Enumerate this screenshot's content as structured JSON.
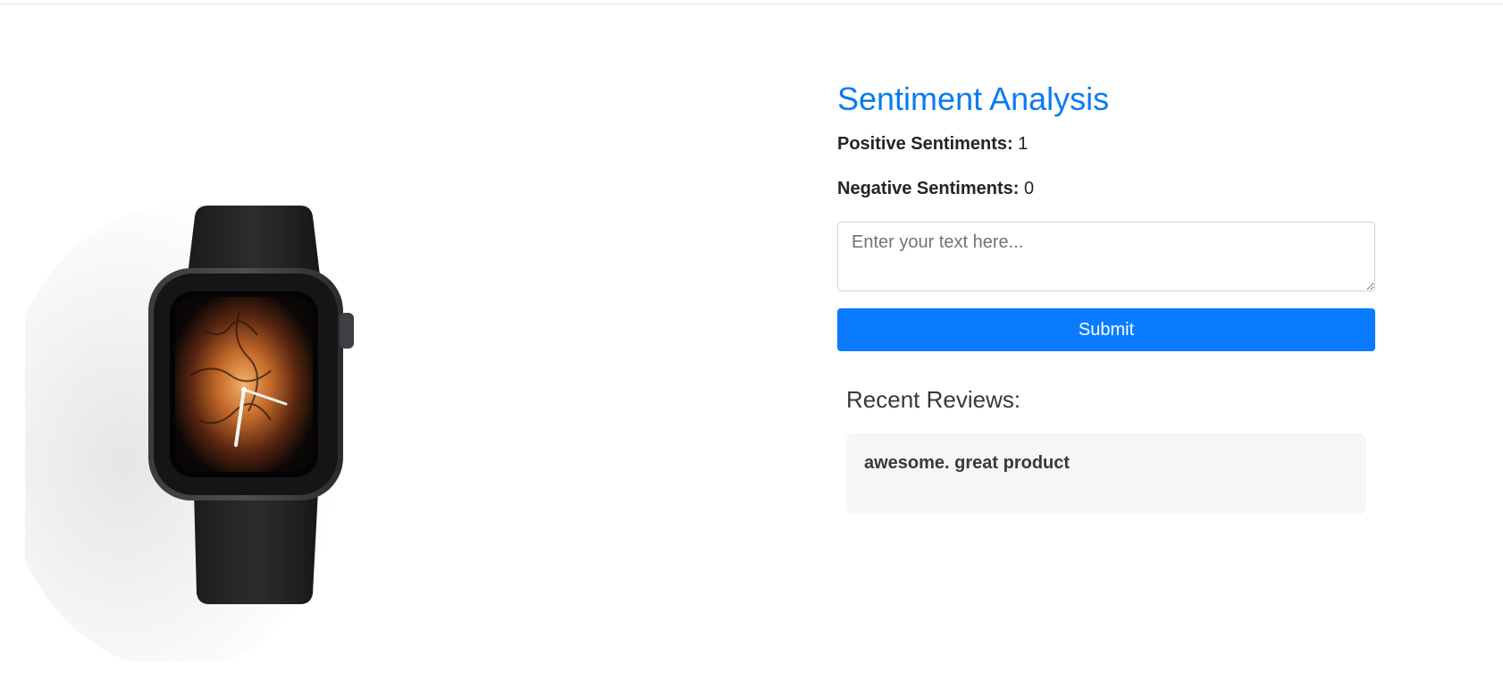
{
  "product": {
    "image_alt": "Smartwatch with black band"
  },
  "analysis": {
    "title": "Sentiment Analysis",
    "positive_label": "Positive Sentiments:",
    "positive_count": "1",
    "negative_label": "Negative Sentiments:",
    "negative_count": "0",
    "input_placeholder": "Enter your text here...",
    "input_value": "",
    "submit_label": "Submit",
    "accent_color": "#0a7bff"
  },
  "reviews": {
    "heading": "Recent Reviews:",
    "items": [
      {
        "text": "awesome. great product"
      }
    ]
  }
}
